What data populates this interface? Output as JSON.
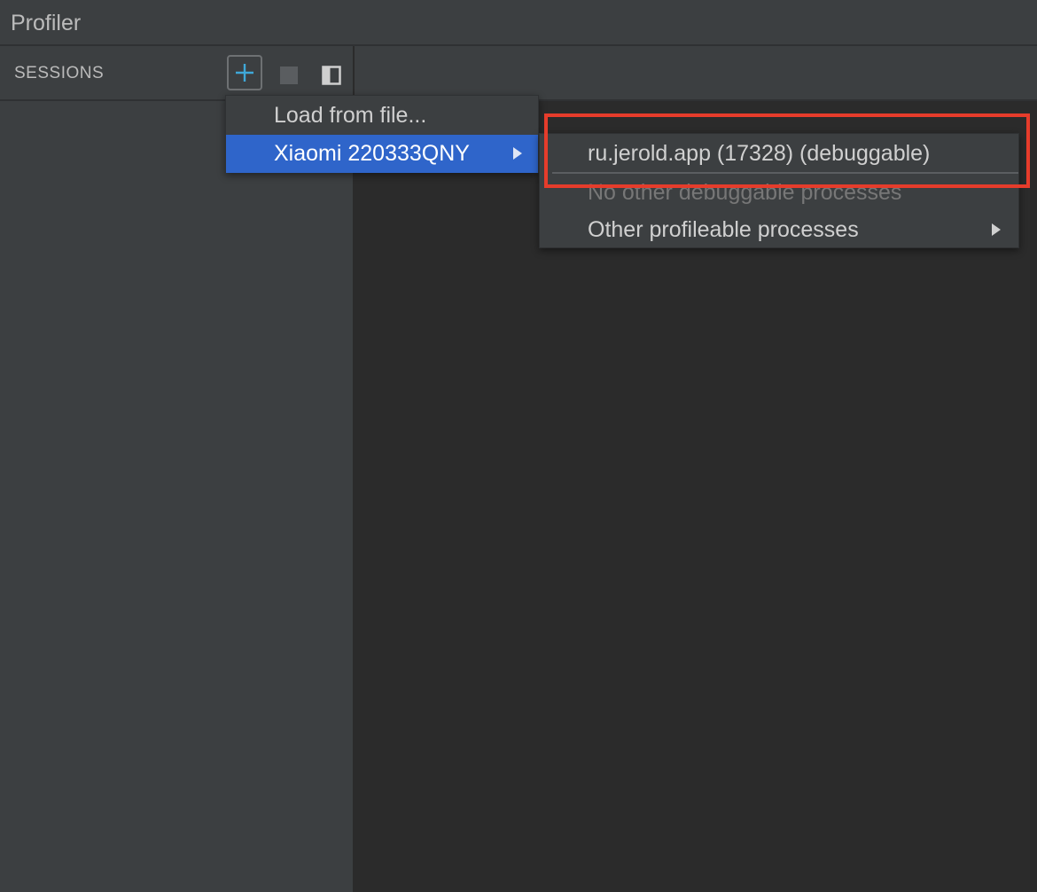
{
  "window": {
    "title": "Profiler"
  },
  "sessions": {
    "label": "SESSIONS",
    "add_icon": "plus-icon",
    "stop_icon": "stop-icon",
    "panel_icon": "panel-layout-icon"
  },
  "menu": {
    "items": [
      {
        "label": "Load from file..."
      },
      {
        "label": "Xiaomi 220333QNY",
        "selected": true,
        "has_submenu": true
      }
    ]
  },
  "submenu": {
    "items": [
      {
        "label": "ru.jerold.app (17328) (debuggable)"
      },
      {
        "label": "No other debuggable processes",
        "disabled": true
      },
      {
        "label": "Other profileable processes",
        "has_submenu": true
      }
    ]
  },
  "colors": {
    "selection": "#2f65ca",
    "highlight_box": "#e63c2b",
    "add_icon": "#3fa8d8"
  }
}
